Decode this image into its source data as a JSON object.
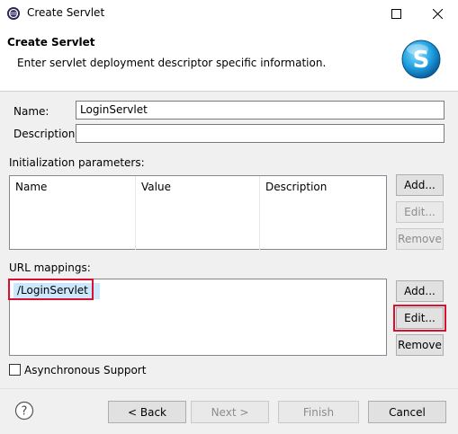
{
  "window": {
    "title": "Create Servlet"
  },
  "banner": {
    "title": "Create Servlet",
    "description": "Enter servlet deployment descriptor specific information."
  },
  "form": {
    "name_label": "Name:",
    "name_value": "LoginServlet",
    "description_label": "Description:",
    "description_value": ""
  },
  "init_params": {
    "label": "Initialization parameters:",
    "columns": [
      "Name",
      "Value",
      "Description"
    ],
    "add": "Add...",
    "edit": "Edit...",
    "remove": "Remove"
  },
  "url_mappings": {
    "label": "URL mappings:",
    "items": [
      "/LoginServlet"
    ],
    "add": "Add...",
    "edit": "Edit...",
    "remove": "Remove"
  },
  "async_label": "Asynchronous Support",
  "footer": {
    "back": "< Back",
    "next": "Next >",
    "finish": "Finish",
    "cancel": "Cancel"
  },
  "colors": {
    "highlight": "#d9112f",
    "selection": "#cce8ff"
  }
}
